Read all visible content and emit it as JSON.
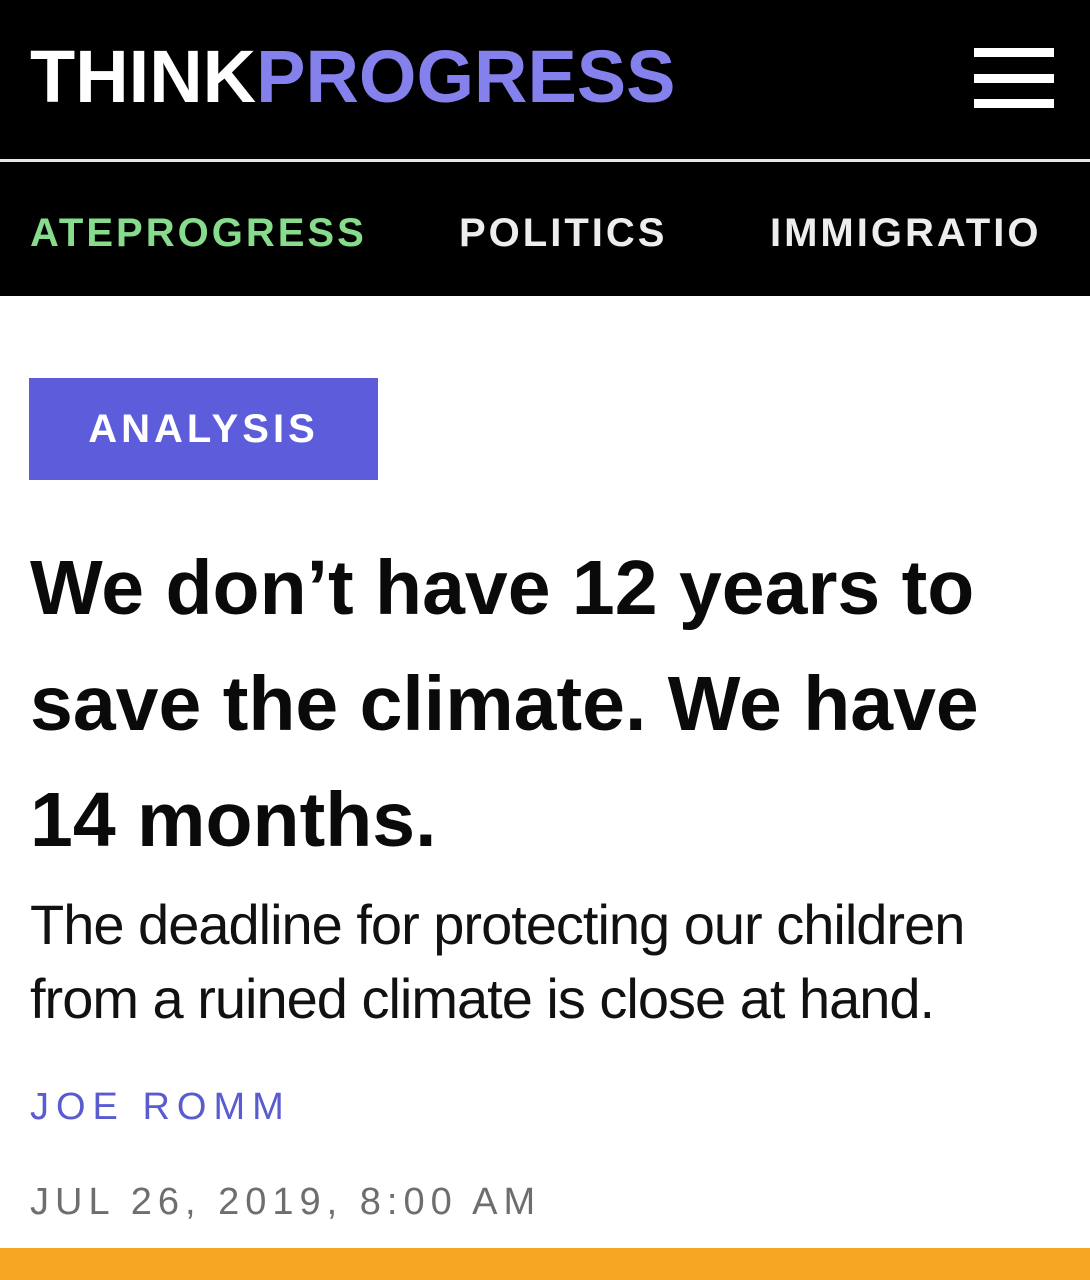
{
  "header": {
    "logo_think": "THINK",
    "logo_progress": "PROGRESS",
    "menu_icon": "hamburger-menu-icon"
  },
  "nav": {
    "items": [
      {
        "label": "ATEPROGRESS"
      },
      {
        "label": "POLITICS"
      },
      {
        "label": "IMMIGRATIO"
      }
    ]
  },
  "article": {
    "category": "ANALYSIS",
    "headline": "We don’t have 12 years to save the climate. We have 14 months.",
    "subheadline": "The deadline for protecting our children from a ruined climate is close at hand.",
    "author": "JOE ROMM",
    "timestamp": "JUL 26, 2019, 8:00 AM"
  },
  "colors": {
    "header_bg": "#000000",
    "logo_accent": "#8480ec",
    "nav_active": "#86dc8c",
    "badge_bg": "#5d5ddb",
    "author_link": "#5b5bd0",
    "bottom_accent": "#f6a623"
  }
}
